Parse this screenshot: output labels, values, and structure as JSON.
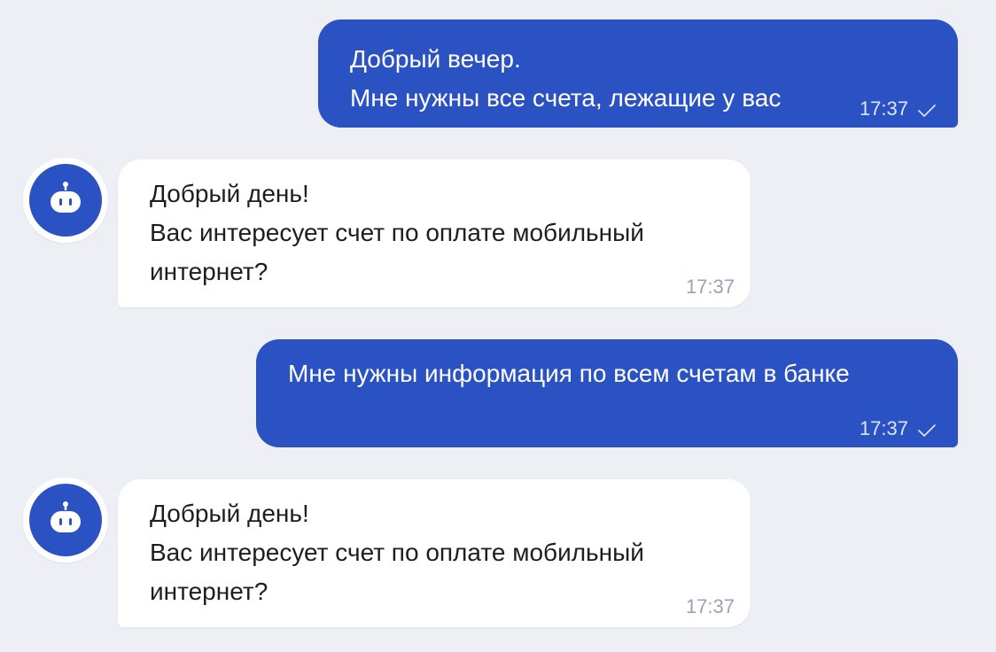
{
  "colors": {
    "background": "#edeff5",
    "outgoing_bubble": "#2b52c3",
    "incoming_bubble": "#ffffff",
    "avatar": "#2b52c3"
  },
  "messages": [
    {
      "direction": "outgoing",
      "lines": [
        "Добрый вечер.",
        "Мне нужны все счета, лежащие у вас"
      ],
      "time": "17:37",
      "status_icon": "check-icon"
    },
    {
      "direction": "incoming",
      "avatar_icon": "robot-icon",
      "lines": [
        "Добрый день!",
        "Вас интересует счет по оплате мобильный",
        "интернет?"
      ],
      "time": "17:37"
    },
    {
      "direction": "outgoing",
      "lines": [
        "Мне нужны информация по всем счетам в банке"
      ],
      "time": "17:37",
      "status_icon": "check-icon"
    },
    {
      "direction": "incoming",
      "avatar_icon": "robot-icon",
      "lines": [
        "Добрый день!",
        "Вас интересует счет по оплате мобильный",
        "интернет?"
      ],
      "time": "17:37"
    }
  ]
}
